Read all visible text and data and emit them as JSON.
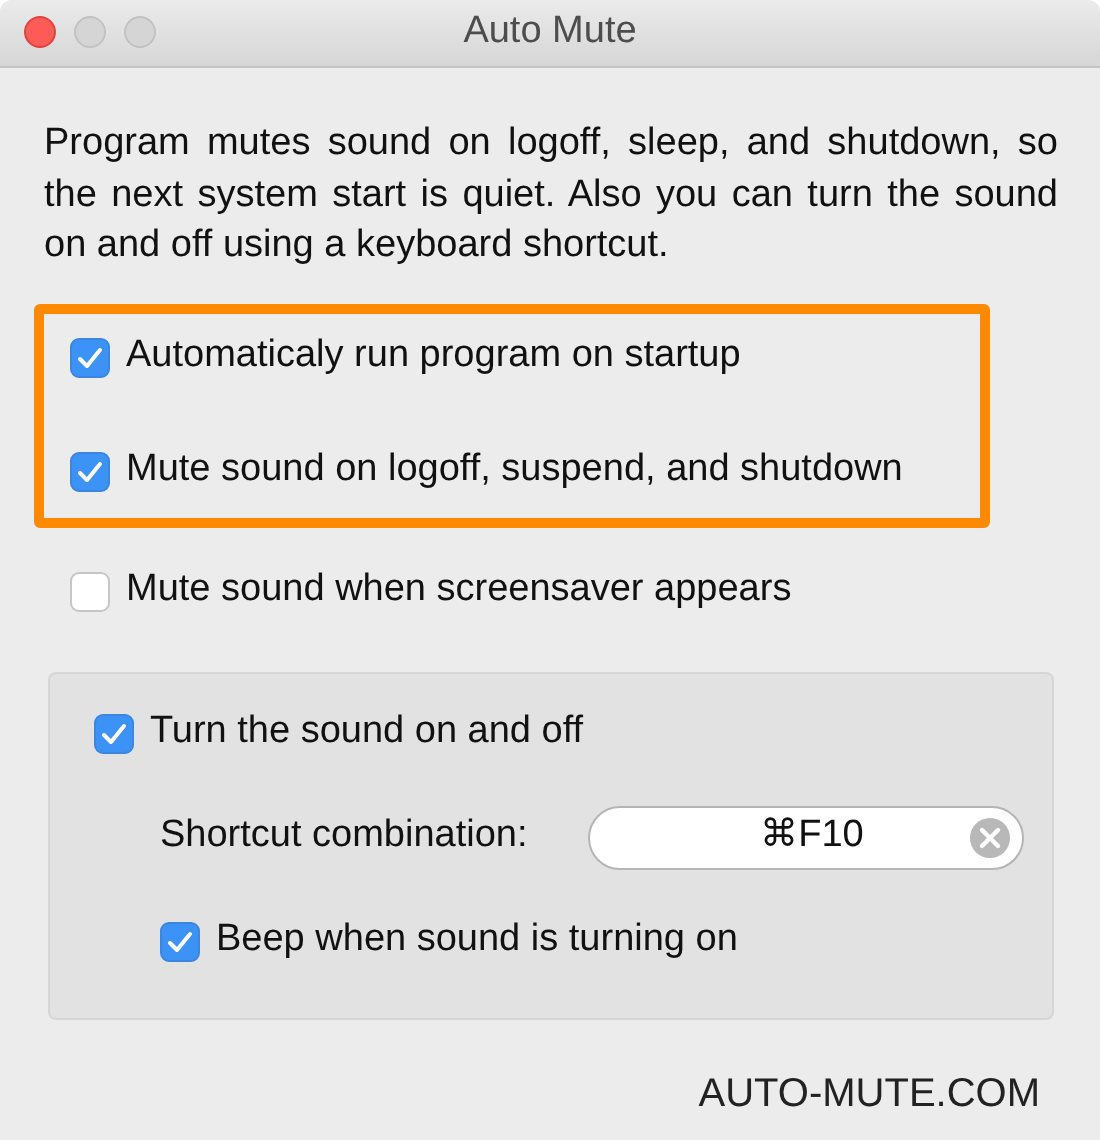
{
  "window": {
    "title": "Auto Mute"
  },
  "description": "Program mutes sound on logoff, sleep, and shutdown, so the next system start is quiet. Also you can turn the sound on and off using a keyboard shortcut.",
  "highlighted_options": [
    {
      "label": "Automaticaly run program on startup",
      "checked": true
    },
    {
      "label": "Mute sound on logoff, suspend, and shutdown",
      "checked": true
    }
  ],
  "options": [
    {
      "label": "Mute sound when screensaver appears",
      "checked": false
    }
  ],
  "toggle_group": {
    "label": "Turn the sound on and off",
    "checked": true,
    "shortcut": {
      "label": "Shortcut combination:",
      "value": "⌘F10"
    },
    "beep": {
      "label": "Beep when sound is turning on",
      "checked": true
    }
  },
  "footer": "AUTO-MUTE.COM"
}
